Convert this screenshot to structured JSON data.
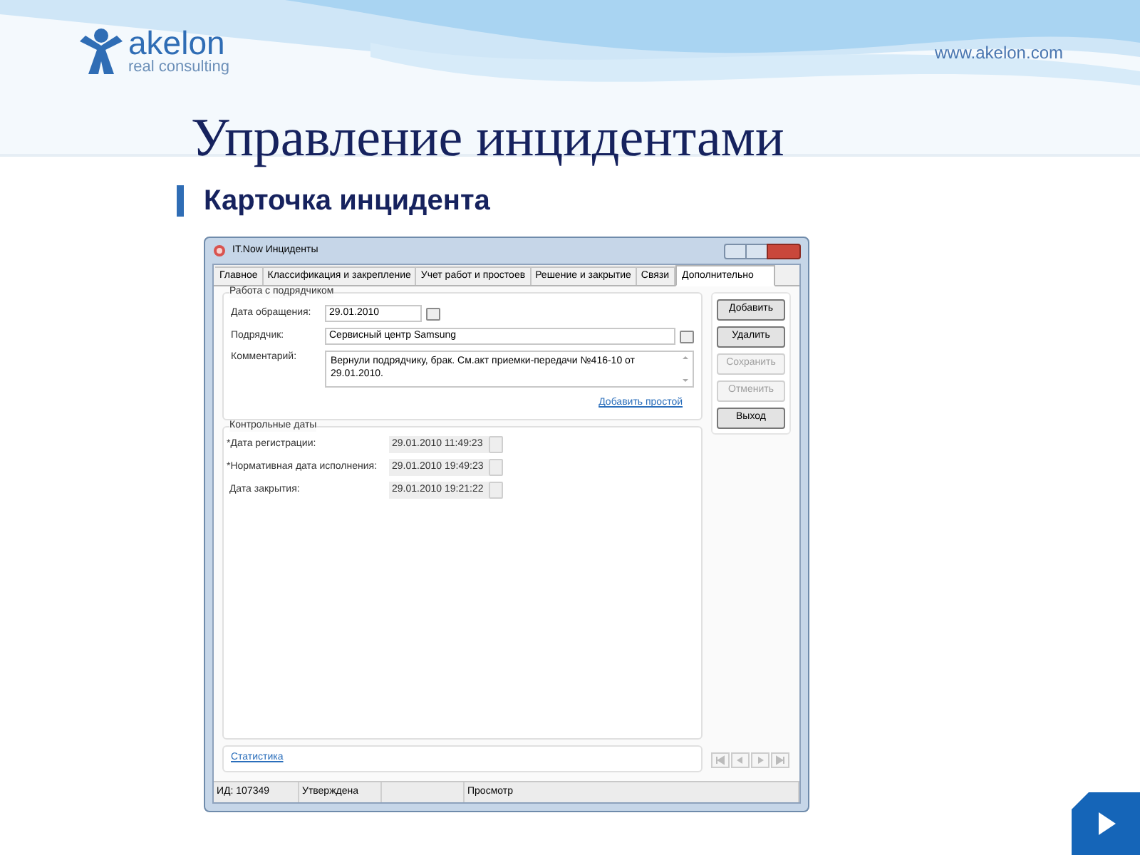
{
  "slide": {
    "logo": {
      "name": "akelon",
      "tagline": "real consulting"
    },
    "url": "www.akelon.com",
    "title": "Управление инцидентами",
    "subtitle": "Карточка инцидента"
  },
  "window": {
    "title": "IT.Now Инциденты",
    "tabs": [
      {
        "label": "Главное",
        "selected": false
      },
      {
        "label": "Классификация и закрепление",
        "selected": false
      },
      {
        "label": "Учет работ и простоев",
        "selected": false
      },
      {
        "label": "Решение и закрытие",
        "selected": false
      },
      {
        "label": "Связи",
        "selected": false
      },
      {
        "label": "Дополнительно",
        "selected": true
      }
    ],
    "contractor_group": {
      "title": "Работа с подрядчиком",
      "date_label": "Дата обращения:",
      "date_value": "29.01.2010",
      "contractor_label": "Подрядчик:",
      "contractor_value": "Сервисный центр Samsung",
      "comment_label": "Комментарий:",
      "comment_value": "Вернули подрядчику, брак. См.акт приемки-передачи №416-10 от 29.01.2010.",
      "link": "Добавить простой"
    },
    "dates_group": {
      "title": "Контрольные даты",
      "rows": [
        {
          "label": "*Дата регистрации:",
          "value": "29.01.2010 11:49:23"
        },
        {
          "label": "*Нормативная дата исполнения:",
          "value": "29.01.2010 19:49:23"
        },
        {
          "label": " Дата закрытия:",
          "value": "29.01.2010 19:21:22"
        }
      ]
    },
    "buttons": [
      {
        "label": "Добавить",
        "disabled": false
      },
      {
        "label": "Удалить",
        "disabled": false
      },
      {
        "label": "Сохранить",
        "disabled": true
      },
      {
        "label": "Отменить",
        "disabled": true
      },
      {
        "label": "Выход",
        "disabled": false
      }
    ],
    "footer_link": "Статистика",
    "status_bar": [
      "ИД: 107349",
      "Утверждена",
      "Просмотр"
    ]
  }
}
